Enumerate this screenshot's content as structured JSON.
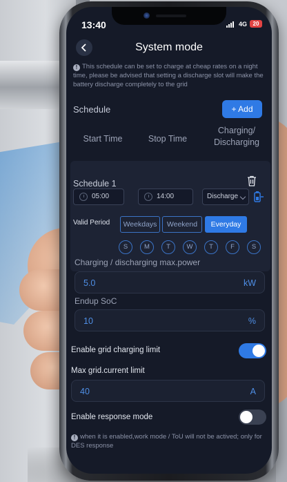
{
  "status_bar": {
    "time": "13:40",
    "network": "4G",
    "battery": "20"
  },
  "header": {
    "title": "System mode"
  },
  "notice": "This schedule can be set to charge at cheap rates on a night time, please be advised that setting a discharge slot will make the battery discharge completely to the grid",
  "schedule": {
    "label": "Schedule",
    "add_label": "+ Add",
    "columns": {
      "start": "Start Time",
      "stop": "Stop Time",
      "charging_line1": "Charging/",
      "charging_line2": "Discharging"
    }
  },
  "schedule_card": {
    "title": "Schedule 1",
    "start_time": "05:00",
    "stop_time": "14:00",
    "mode": "Discharge",
    "valid_period_label": "Valid Period",
    "periods": [
      "Weekdays",
      "Weekend",
      "Everyday"
    ],
    "selected_period": "Everyday",
    "days": [
      "S",
      "M",
      "T",
      "W",
      "T",
      "F",
      "S"
    ]
  },
  "max_power": {
    "label": "Charging / discharging max.power",
    "value": "5.0",
    "unit": "kW"
  },
  "endup_soc": {
    "label": "Endup SoC",
    "value": "10",
    "unit": "%"
  },
  "grid_limit_toggle": {
    "label": "Enable grid charging limit",
    "enabled": true
  },
  "max_grid_current": {
    "label": "Max grid.current limit",
    "value": "40",
    "unit": "A"
  },
  "response_mode_toggle": {
    "label": "Enable response mode",
    "enabled": false
  },
  "footnote": "when it is enabled,work mode / ToU will not be actived; only for DES response",
  "colors": {
    "accent": "#2f7ae5",
    "screen_bg": "#151a28",
    "value_text": "#4f8fe6"
  }
}
